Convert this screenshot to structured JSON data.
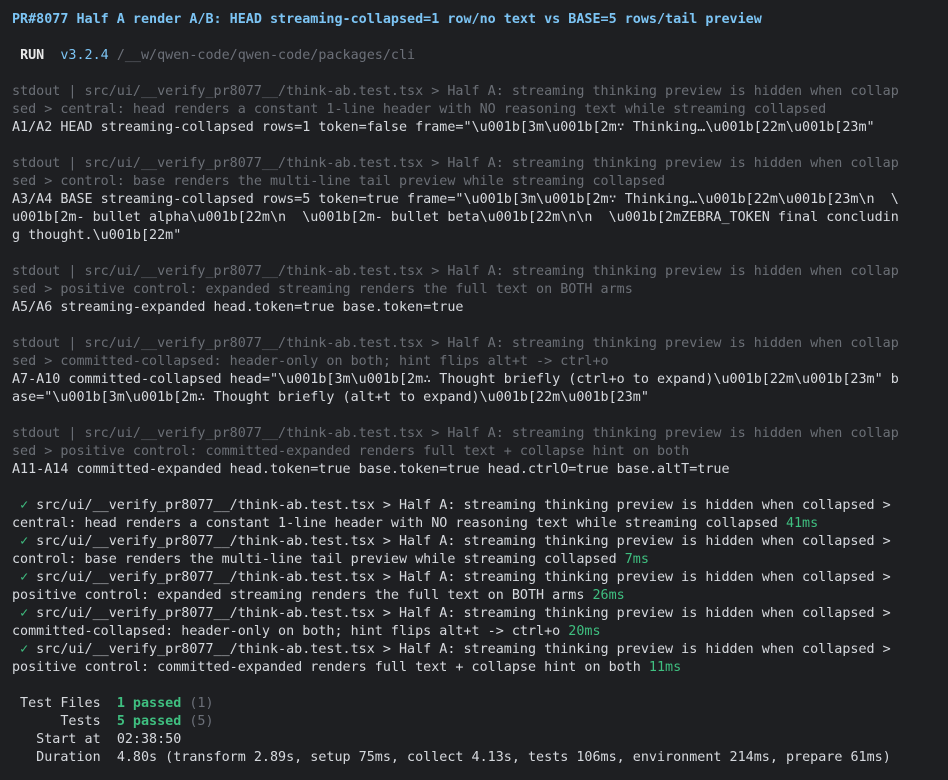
{
  "title": "PR#8077 Half A render A/B: HEAD streaming-collapsed=1 row/no text vs BASE=5 rows/tail preview",
  "run": {
    "label": "RUN",
    "version": "v3.2.4",
    "path": "/__w/qwen-code/qwen-code/packages/cli"
  },
  "stdout_blocks": [
    {
      "header": [
        "stdout | src/ui/__verify_pr8077__/think-ab.test.tsx > Half A: streaming thinking preview is hidden when collap",
        "sed > central: head renders a constant 1-line header with NO reasoning text while streaming collapsed"
      ],
      "body": [
        "A1/A2 HEAD streaming-collapsed rows=1 token=false frame=\"\\u001b[3m\\u001b[2m∵ Thinking…\\u001b[22m\\u001b[23m\""
      ]
    },
    {
      "header": [
        "stdout | src/ui/__verify_pr8077__/think-ab.test.tsx > Half A: streaming thinking preview is hidden when collap",
        "sed > control: base renders the multi-line tail preview while streaming collapsed"
      ],
      "body": [
        "A3/A4 BASE streaming-collapsed rows=5 token=true frame=\"\\u001b[3m\\u001b[2m∵ Thinking…\\u001b[22m\\u001b[23m\\n  \\",
        "u001b[2m- bullet alpha\\u001b[22m\\n  \\u001b[2m- bullet beta\\u001b[22m\\n\\n  \\u001b[2mZEBRA_TOKEN final concludin",
        "g thought.\\u001b[22m\""
      ]
    },
    {
      "header": [
        "stdout | src/ui/__verify_pr8077__/think-ab.test.tsx > Half A: streaming thinking preview is hidden when collap",
        "sed > positive control: expanded streaming renders the full text on BOTH arms"
      ],
      "body": [
        "A5/A6 streaming-expanded head.token=true base.token=true"
      ]
    },
    {
      "header": [
        "stdout | src/ui/__verify_pr8077__/think-ab.test.tsx > Half A: streaming thinking preview is hidden when collap",
        "sed > committed-collapsed: header-only on both; hint flips alt+t -> ctrl+o"
      ],
      "body": [
        "A7-A10 committed-collapsed head=\"\\u001b[3m\\u001b[2m∴ Thought briefly (ctrl+o to expand)\\u001b[22m\\u001b[23m\" b",
        "ase=\"\\u001b[3m\\u001b[2m∴ Thought briefly (alt+t to expand)\\u001b[22m\\u001b[23m\""
      ]
    },
    {
      "header": [
        "stdout | src/ui/__verify_pr8077__/think-ab.test.tsx > Half A: streaming thinking preview is hidden when collap",
        "sed > positive control: committed-expanded renders full text + collapse hint on both"
      ],
      "body": [
        "A11-A14 committed-expanded head.token=true base.token=true head.ctrlO=true base.altT=true"
      ]
    }
  ],
  "results": [
    {
      "check": "✓",
      "line1": " src/ui/__verify_pr8077__/think-ab.test.tsx > Half A: streaming thinking preview is hidden when collapsed >",
      "line2": "central: head renders a constant 1-line header with NO reasoning text while streaming collapsed ",
      "time": "41ms"
    },
    {
      "check": "✓",
      "line1": " src/ui/__verify_pr8077__/think-ab.test.tsx > Half A: streaming thinking preview is hidden when collapsed >",
      "line2": "control: base renders the multi-line tail preview while streaming collapsed ",
      "time": "7ms"
    },
    {
      "check": "✓",
      "line1": " src/ui/__verify_pr8077__/think-ab.test.tsx > Half A: streaming thinking preview is hidden when collapsed >",
      "line2": "positive control: expanded streaming renders the full text on BOTH arms ",
      "time": "26ms"
    },
    {
      "check": "✓",
      "line1": " src/ui/__verify_pr8077__/think-ab.test.tsx > Half A: streaming thinking preview is hidden when collapsed >",
      "line2": "committed-collapsed: header-only on both; hint flips alt+t -> ctrl+o ",
      "time": "20ms"
    },
    {
      "check": "✓",
      "line1": " src/ui/__verify_pr8077__/think-ab.test.tsx > Half A: streaming thinking preview is hidden when collapsed >",
      "line2": "positive control: committed-expanded renders full text + collapse hint on both ",
      "time": "11ms"
    }
  ],
  "summary": {
    "test_files_label": " Test Files  ",
    "test_files_passed": "1 passed",
    "test_files_total": " (1)",
    "tests_label": "      Tests  ",
    "tests_passed": "5 passed",
    "tests_total": " (5)",
    "start_label": "   Start at  ",
    "start_value": "02:38:50",
    "duration_label": "   Duration  ",
    "duration_value": "4.80s (transform 2.89s, setup 75ms, collect 4.13s, tests 106ms, environment 214ms, prepare 61ms)"
  },
  "colors": {
    "background": "#1e1f22",
    "title": "#7cc4f4",
    "pass": "#3fbf80",
    "dim": "#6b6f76",
    "text": "#d6d9de"
  }
}
